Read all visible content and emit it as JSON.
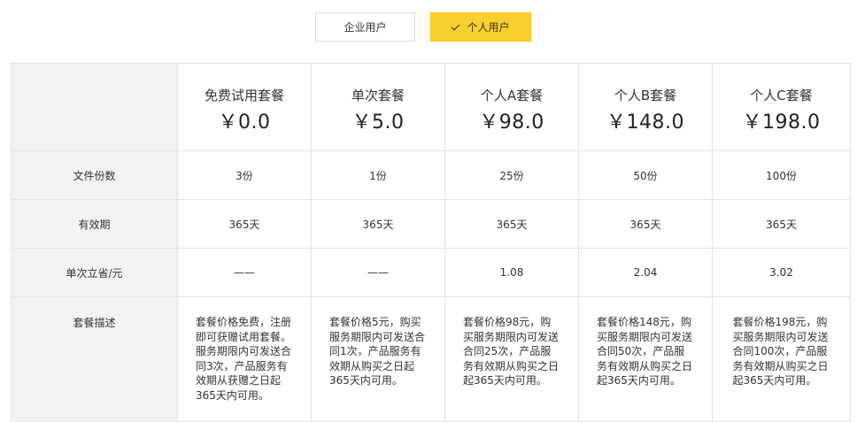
{
  "tabs": {
    "enterprise": "企业用户",
    "personal": "个人用户",
    "active": "personal"
  },
  "table": {
    "row_labels": [
      "文件份数",
      "有效期",
      "单次立省/元",
      "套餐描述"
    ],
    "plans": [
      {
        "name": "免费试用套餐",
        "price": "￥0.0",
        "files": "3份",
        "validity": "365天",
        "saving": "——",
        "desc": "套餐价格免费，注册即可获赠试用套餐。服务期限内可发送合同3次，产品服务有效期从获赠之日起365天内可用。"
      },
      {
        "name": "单次套餐",
        "price": "￥5.0",
        "files": "1份",
        "validity": "365天",
        "saving": "——",
        "desc": "套餐价格5元，购买服务期限内可发送合同1次，产品服务有效期从购买之日起365天内可用。"
      },
      {
        "name": "个人A套餐",
        "price": "￥98.0",
        "files": "25份",
        "validity": "365天",
        "saving": "1.08",
        "desc": "套餐价格98元，购买服务期限内可发送合同25次，产品服务有效期从购买之日起365天内可用。"
      },
      {
        "name": "个人B套餐",
        "price": "￥148.0",
        "files": "50份",
        "validity": "365天",
        "saving": "2.04",
        "desc": "套餐价格148元，购买服务期限内可发送合同50次，产品服务有效期从购买之日起365天内可用。"
      },
      {
        "name": "个人C套餐",
        "price": "￥198.0",
        "files": "100份",
        "validity": "365天",
        "saving": "3.02",
        "desc": "套餐价格198元，购买服务期限内可发送合同100次，产品服务有效期从购买之日起365天内可用。"
      }
    ]
  },
  "colors": {
    "accent": "#f9cf2d",
    "label_bg": "#f2f2f2",
    "border": "#e3e3e3"
  }
}
